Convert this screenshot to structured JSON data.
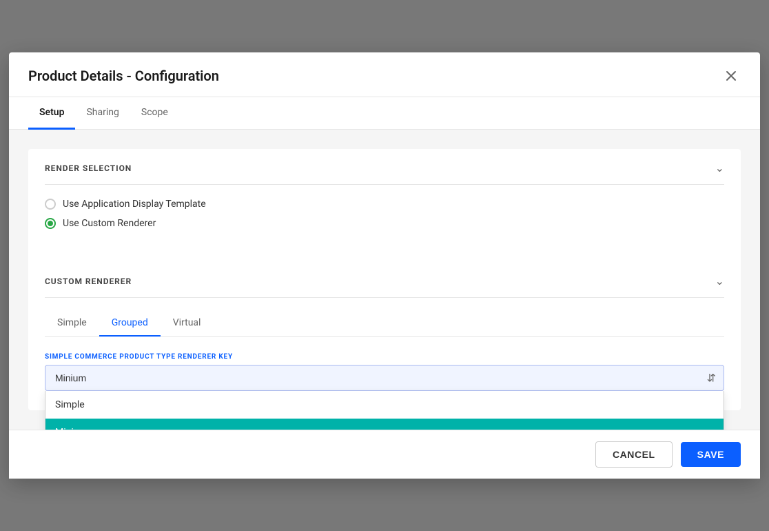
{
  "modal": {
    "title": "Product Details - Configuration",
    "close_label": "×"
  },
  "tabs": [
    {
      "id": "setup",
      "label": "Setup",
      "active": true
    },
    {
      "id": "sharing",
      "label": "Sharing",
      "active": false
    },
    {
      "id": "scope",
      "label": "Scope",
      "active": false
    }
  ],
  "sections": {
    "render_selection": {
      "title": "RENDER SELECTION",
      "options": [
        {
          "id": "app-display",
          "label": "Use Application Display Template",
          "selected": false
        },
        {
          "id": "custom-renderer",
          "label": "Use Custom Renderer",
          "selected": true
        }
      ]
    },
    "custom_renderer": {
      "title": "CUSTOM RENDERER",
      "renderer_tabs": [
        {
          "id": "simple",
          "label": "Simple",
          "active": false
        },
        {
          "id": "grouped",
          "label": "Grouped",
          "active": true
        },
        {
          "id": "virtual",
          "label": "Virtual",
          "active": false
        }
      ],
      "field_label": "SIMPLE COMMERCE PRODUCT TYPE RENDERER KEY",
      "select_value": "Minium",
      "dropdown_options": [
        {
          "value": "Simple",
          "label": "Simple",
          "selected": false
        },
        {
          "value": "Minium",
          "label": "Minium",
          "selected": true
        }
      ]
    }
  },
  "footer": {
    "cancel_label": "CANCEL",
    "save_label": "SAVE"
  }
}
